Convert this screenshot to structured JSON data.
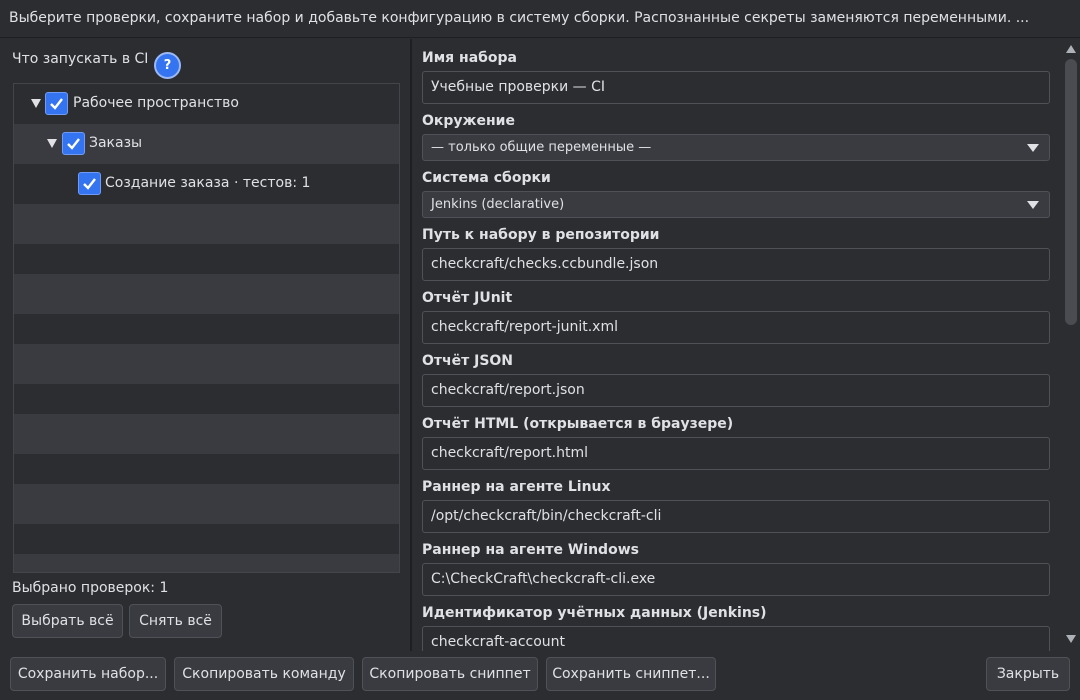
{
  "banner": {
    "text": "Выберите проверки, сохраните набор и добавьте конфигурацию в систему сборки. Распознанные секреты заменяются переменными. ..."
  },
  "left": {
    "ci_label": "Что запускать в CI",
    "help_glyph": "?",
    "tree": [
      {
        "label": "Рабочее пространство",
        "checked": true,
        "expanded": true
      },
      {
        "label": "Заказы",
        "checked": true,
        "expanded": true
      },
      {
        "label": "Создание заказа",
        "suffix": "· тестов: 1",
        "checked": true
      }
    ],
    "selected_count": "Выбрано проверок: 1",
    "select_all": "Выбрать всё",
    "deselect_all": "Снять всё"
  },
  "form": {
    "set_name": {
      "label": "Имя набора",
      "value": "Учебные проверки — CI"
    },
    "environment": {
      "label": "Окружение",
      "value": "— только общие переменные —"
    },
    "build_system": {
      "label": "Система сборки",
      "value": "Jenkins (declarative)"
    },
    "repo_path": {
      "label": "Путь к набору в репозитории",
      "value": "checkcraft/checks.ccbundle.json"
    },
    "junit": {
      "label": "Отчёт JUnit",
      "value": "checkcraft/report-junit.xml"
    },
    "json_report": {
      "label": "Отчёт JSON",
      "value": "checkcraft/report.json"
    },
    "html_report": {
      "label": "Отчёт HTML (открывается в браузере)",
      "value": "checkcraft/report.html"
    },
    "linux_runner": {
      "label": "Раннер на агенте Linux",
      "value": "/opt/checkcraft/bin/checkcraft-cli"
    },
    "windows_runner": {
      "label": "Раннер на агенте Windows",
      "value": "C:\\CheckCraft\\checkcraft-cli.exe"
    },
    "credentials": {
      "label": "Идентификатор учётных данных (Jenkins)",
      "value": "checkcraft-account"
    }
  },
  "bottom": {
    "save_set": "Сохранить набор...",
    "copy_command": "Скопировать команду",
    "copy_snippet": "Скопировать сниппет",
    "save_snippet": "Сохранить сниппет...",
    "close": "Закрыть"
  },
  "colors": {
    "accent": "#3574f0",
    "background": "#2b2d30",
    "row_alt": "#393b40"
  }
}
